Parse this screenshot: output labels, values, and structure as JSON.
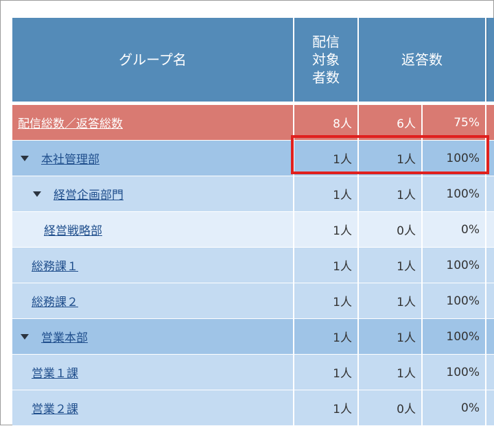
{
  "header": {
    "group_name": "グループ名",
    "recipients": "配信\n対象\n者数",
    "responses": "返答数"
  },
  "total_row": {
    "label": "配信総数／返答総数",
    "recipients": "8人",
    "responses": "6人",
    "rate": "75%"
  },
  "rows": [
    {
      "label": "本社管理部",
      "recipients": "1人",
      "responses": "1人",
      "rate": "100%",
      "expander": true
    },
    {
      "label": "経営企画部門",
      "recipients": "1人",
      "responses": "1人",
      "rate": "100%",
      "expander": true
    },
    {
      "label": "経営戦略部",
      "recipients": "1人",
      "responses": "0人",
      "rate": "0%",
      "expander": false
    },
    {
      "label": "総務課１",
      "recipients": "1人",
      "responses": "1人",
      "rate": "100%",
      "expander": false
    },
    {
      "label": "総務課２",
      "recipients": "1人",
      "responses": "1人",
      "rate": "100%",
      "expander": false
    },
    {
      "label": "営業本部",
      "recipients": "1人",
      "responses": "1人",
      "rate": "100%",
      "expander": true
    },
    {
      "label": "営業１課",
      "recipients": "1人",
      "responses": "1人",
      "rate": "100%",
      "expander": false
    },
    {
      "label": "営業２課",
      "recipients": "1人",
      "responses": "0人",
      "rate": "0%",
      "expander": false
    }
  ],
  "colors": {
    "header_bg": "#548bb8",
    "total_bg": "#d97a72",
    "level1_bg": "#9fc4e7",
    "level2_bg": "#c4dbf2",
    "level3_bg": "#e3eefa",
    "highlight": "#e0201e",
    "link": "#1f4e8c"
  },
  "icons": {
    "expander": "triangle-down-icon"
  }
}
